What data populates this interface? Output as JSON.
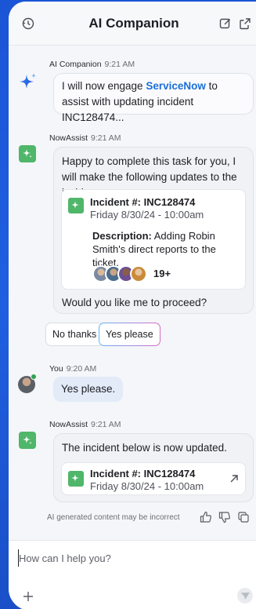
{
  "header": {
    "title": "AI Companion",
    "left_icon": "history-icon",
    "right_icons": [
      "new-chat-icon",
      "pop-out-icon"
    ]
  },
  "messages": {
    "ai_companion": {
      "sender": "AI Companion",
      "time": "9:21 AM",
      "text_before": "I will now engage ",
      "highlight": "ServiceNow",
      "text_after": " to assist with updating incident INC128474..."
    },
    "nowassist_1": {
      "sender": "NowAssist",
      "time": "9:21 AM",
      "intro": "Happy to complete this task for you, I will make the following updates to the incident:",
      "card": {
        "title": "Incident #: INC128474",
        "subtitle": "Friday 8/30/24 - 10:00am",
        "description_label": "Description:",
        "description_text": " Adding Robin Smith's direct reports to the ticket.",
        "avatar_count": "19+"
      },
      "question": "Would you like me to proceed?"
    },
    "actions": {
      "no_label": "No thanks",
      "yes_label": "Yes please"
    },
    "user": {
      "sender": "You",
      "time": "9:20 AM",
      "text": "Yes please."
    },
    "nowassist_2": {
      "sender": "NowAssist",
      "time": "9:21 AM",
      "text": "The incident below is now updated.",
      "card": {
        "title": "Incident #: INC128474",
        "subtitle": "Friday 8/30/24 - 10:00am"
      }
    }
  },
  "disclaimer": "AI generated content may be incorrect",
  "composer": {
    "placeholder": "How can I help you?"
  },
  "colors": {
    "brand_blue": "#1a55d6",
    "nowassist_green": "#4fb66a",
    "link_blue": "#1a6fd8",
    "online_green": "#2ea44f"
  }
}
